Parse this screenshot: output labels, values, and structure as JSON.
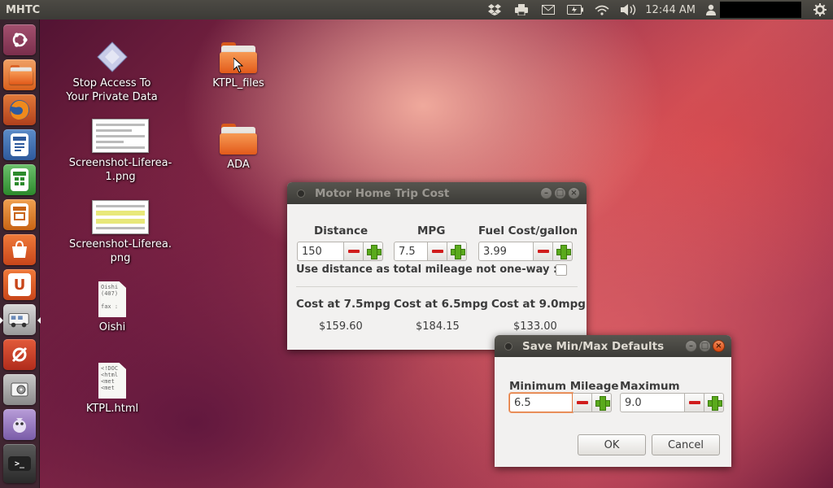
{
  "top_panel": {
    "app_title": "MHTC",
    "clock": "12:44 AM",
    "indicators": [
      "dropbox-icon",
      "printer-icon",
      "mail-icon",
      "battery-icon",
      "wifi-icon",
      "volume-icon"
    ]
  },
  "launcher": {
    "items": [
      "ubuntu-dash",
      "home-folder",
      "firefox",
      "libreoffice-writer",
      "libreoffice-calc",
      "libreoffice-impress",
      "ubuntu-software-center",
      "ubuntu-one",
      "motor-home-app",
      "system-settings",
      "disk-utility",
      "pidgin",
      "terminal-stack"
    ]
  },
  "desktop": {
    "icons": [
      {
        "label": "Stop Access To\nYour Private Data",
        "kind": "shortcut"
      },
      {
        "label": "KTPL_files",
        "kind": "folder"
      },
      {
        "label": "Screenshot-Liferea-\n1.png",
        "kind": "image"
      },
      {
        "label": "ADA",
        "kind": "folder"
      },
      {
        "label": "Screenshot-Liferea.\npng",
        "kind": "image"
      },
      {
        "label": "Oishi",
        "kind": "text",
        "preview": "Oishi\n(407)\n\nfax :"
      },
      {
        "label": "KTPL.html",
        "kind": "html",
        "preview": "<!DOC\n<html\n<met\n<met"
      }
    ]
  },
  "trip_window": {
    "title": "Motor Home Trip Cost",
    "distance_label": "Distance",
    "distance_value": "150",
    "mpg_label": "MPG",
    "mpg_value": "7.5",
    "fuel_label": "Fuel Cost/gallon",
    "fuel_value": "3.99",
    "checkbox_label": "Use distance as total mileage not one-way :",
    "costs": [
      {
        "label": "Cost at 7.5mpg",
        "value": "$159.60"
      },
      {
        "label": "Cost at 6.5mpg",
        "value": "$184.15"
      },
      {
        "label": "Cost at 9.0mpg",
        "value": "$133.00"
      }
    ]
  },
  "defaults_dialog": {
    "title": "Save Min/Max Defaults",
    "min_label": "Minimum Mileage",
    "min_value": "6.5",
    "max_label": "Maximum Mileage",
    "max_value": "9.0",
    "ok_label": "OK",
    "cancel_label": "Cancel"
  },
  "colors": {
    "panel": "#3c3b37",
    "accent_orange": "#e25a1a",
    "minus_red": "#d01c1c",
    "plus_green": "#5aaa1c"
  }
}
